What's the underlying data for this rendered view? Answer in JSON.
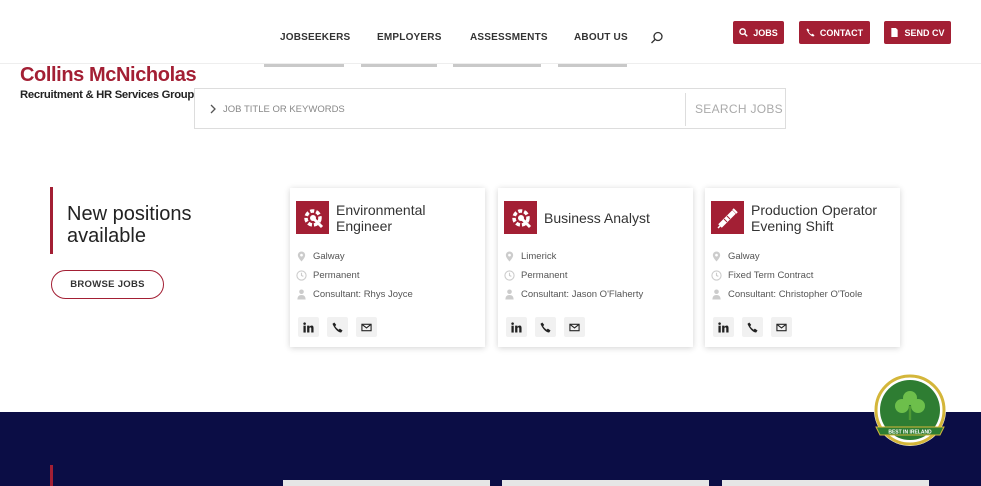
{
  "header": {
    "nav": [
      "JOBSEEKERS",
      "EMPLOYERS",
      "ASSESSMENTS",
      "ABOUT US"
    ],
    "buttons": {
      "jobs": "JOBS",
      "contact": "CONTACT",
      "send_cv": "SEND CV"
    }
  },
  "logo": {
    "main": "Collins McNicholas",
    "sub": "Recruitment & HR Services Group"
  },
  "search": {
    "placeholder": "JOB TITLE OR KEYWORDS",
    "button": "SEARCH JOBS"
  },
  "promo": {
    "title": "New positions available",
    "button": "BROWSE JOBS"
  },
  "jobs": [
    {
      "title": "Environmental Engineer",
      "location": "Galway",
      "type": "Permanent",
      "consultant": "Consultant: Rhys Joyce",
      "icon": "gear-wrench-icon"
    },
    {
      "title": "Business Analyst",
      "location": "Limerick",
      "type": "Permanent",
      "consultant": "Consultant: Jason O'Flaherty",
      "icon": "gear-wrench-icon"
    },
    {
      "title": "Production Operator Evening Shift",
      "location": "Galway",
      "type": "Fixed Term Contract",
      "consultant": "Consultant: Christopher O'Toole",
      "icon": "syringe-icon"
    }
  ],
  "badge": {
    "text": "BEST IN IRELAND"
  },
  "colors": {
    "brand": "#a31f34",
    "navy": "#0b0d45",
    "badge_green": "#2e7d32"
  }
}
